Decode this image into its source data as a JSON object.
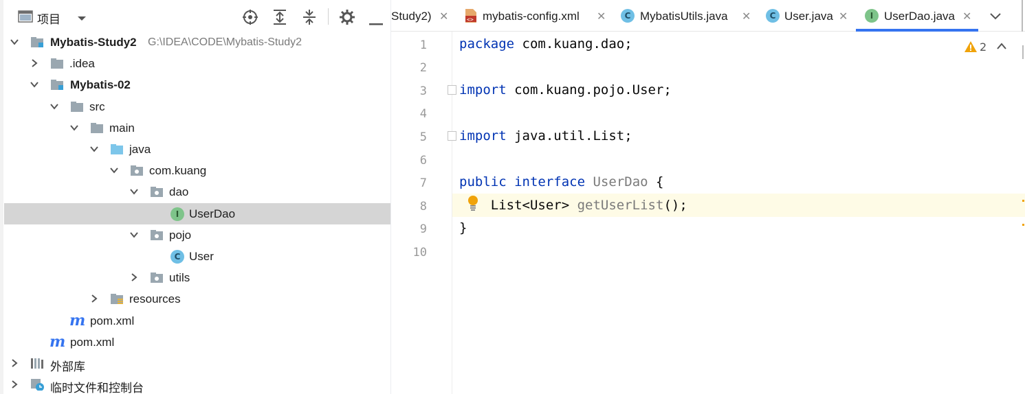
{
  "project": {
    "title": "项目",
    "tree": [
      {
        "label": "Mybatis-Study2",
        "path": "G:\\IDEA\\CODE\\Mybatis-Study2",
        "bold": true
      },
      {
        "label": ".idea"
      },
      {
        "label": "Mybatis-02",
        "bold": true
      },
      {
        "label": "src"
      },
      {
        "label": "main"
      },
      {
        "label": "java"
      },
      {
        "label": "com.kuang"
      },
      {
        "label": "dao"
      },
      {
        "label": "UserDao",
        "badge": "I"
      },
      {
        "label": "pojo"
      },
      {
        "label": "User",
        "badge": "C"
      },
      {
        "label": "utils"
      },
      {
        "label": "resources"
      },
      {
        "label": "pom.xml"
      },
      {
        "label": "pom.xml"
      },
      {
        "label": "外部库"
      },
      {
        "label": "临时文件和控制台"
      }
    ]
  },
  "tabs": [
    {
      "label": "Study2)"
    },
    {
      "label": "mybatis-config.xml"
    },
    {
      "label": "MybatisUtils.java",
      "badge": "C"
    },
    {
      "label": "User.java",
      "badge": "C"
    },
    {
      "label": "UserDao.java",
      "badge": "I",
      "active": true
    }
  ],
  "close_glyph": "✕",
  "editor": {
    "warning_count": "2",
    "line_numbers": [
      "1",
      "2",
      "3",
      "4",
      "5",
      "6",
      "7",
      "8",
      "9",
      "10"
    ],
    "lines": {
      "l1_kw": "package",
      "l1_rest": " com.kuang.dao;",
      "l3_kw": "import",
      "l3_rest": " com.kuang.pojo.User;",
      "l5_kw": "import",
      "l5_rest": " java.util.List;",
      "l7_kw1": "public",
      "l7_kw2": "interface",
      "l7_name": "UserDao",
      "l7_brace": " {",
      "l8_type": "    List<User> ",
      "l8_method": "getUserList",
      "l8_end": "();",
      "l9": "}"
    }
  },
  "colors": {
    "accent": "#3574f0",
    "keyword": "#0033b3",
    "interface_badge": "#7ec48a",
    "class_badge": "#6fbfe5",
    "selection": "#d5d5d5",
    "caret_line": "#fefbe6",
    "warning": "#f0a30a"
  }
}
